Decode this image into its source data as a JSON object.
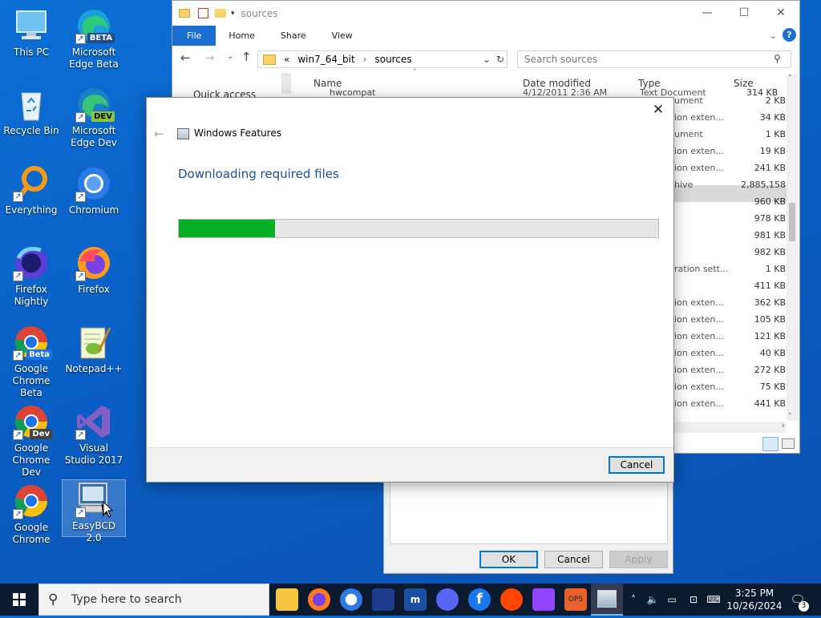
{
  "desktop": {
    "icons": [
      {
        "label": "This PC"
      },
      {
        "label": "Microsoft Edge Beta",
        "badge": "BETA"
      },
      {
        "label": "Recycle Bin"
      },
      {
        "label": "Microsoft Edge Dev",
        "badge": "DEV"
      },
      {
        "label": "Everything"
      },
      {
        "label": "Chromium"
      },
      {
        "label": "Firefox Nightly"
      },
      {
        "label": "Firefox"
      },
      {
        "label": "Google Chrome Beta",
        "badge": "Beta"
      },
      {
        "label": "Notepad++"
      },
      {
        "label": "Google Chrome Dev",
        "badge": "Dev"
      },
      {
        "label": "Visual Studio 2017"
      },
      {
        "label": "Google Chrome"
      },
      {
        "label": "EasyBCD 2.0"
      }
    ]
  },
  "explorer": {
    "title": "sources",
    "ribbon_tabs": [
      "File",
      "Home",
      "Share",
      "View"
    ],
    "address": {
      "prefix": "«",
      "segments": [
        "win7_64_bit",
        "sources"
      ]
    },
    "search_placeholder": "Search sources",
    "nav": {
      "quick_access": "Quick access"
    },
    "columns": {
      "name": "Name",
      "date": "Date modified",
      "type": "Type",
      "size": "Size"
    },
    "partial_row": {
      "name": "hwcompat",
      "date": "4/12/2011 2:36 AM",
      "type": "Text Document",
      "size": "314 KB"
    },
    "types": [
      "ument",
      "ion exten...",
      "ument",
      "ion exten...",
      "ion exten...",
      "hive",
      "",
      "",
      "",
      "",
      "ration sett...",
      "",
      "ion exten...",
      "ion exten...",
      "ion exten...",
      "ion exten...",
      "ion exten...",
      "ion exten...",
      "ion exten..."
    ],
    "sizes": [
      "2 KB",
      "34 KB",
      "1 KB",
      "19 KB",
      "241 KB",
      "2,885,158 KB",
      "960 KB",
      "978 KB",
      "981 KB",
      "982 KB",
      "1 KB",
      "411 KB",
      "362 KB",
      "105 KB",
      "121 KB",
      "40 KB",
      "272 KB",
      "75 KB",
      "441 KB"
    ]
  },
  "properties": {
    "ok": "OK",
    "cancel": "Cancel",
    "apply": "Apply"
  },
  "dialog": {
    "title": "Windows Features",
    "heading": "Downloading required files",
    "progress": 0.2,
    "cancel": "Cancel",
    "colors": {
      "progress_fill": "#06b025",
      "heading": "#1c4f9a"
    }
  },
  "taskbar": {
    "search_placeholder": "Type here to search",
    "apps": [
      "file-explorer",
      "firefox",
      "chromium",
      "media-player",
      "malwarebytes",
      "discord",
      "facebook",
      "reddit",
      "twitch",
      "ops",
      "windows-features"
    ],
    "time": "3:25 PM",
    "date": "10/26/2024",
    "notifications": "3"
  }
}
